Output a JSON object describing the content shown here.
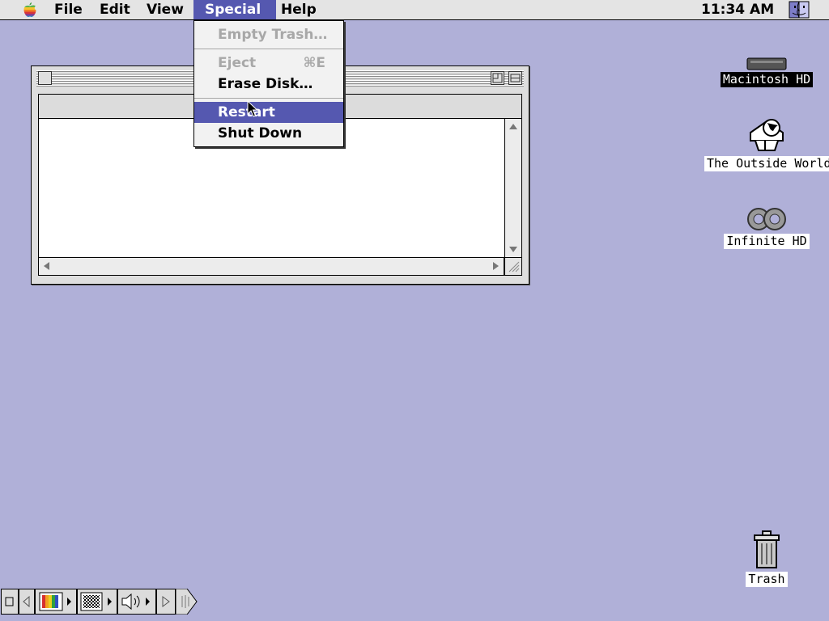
{
  "menubar": {
    "apple_icon": "rainbow-apple-icon",
    "menus": [
      "File",
      "Edit",
      "View",
      "Special",
      "Help"
    ],
    "active_menu": "Special",
    "clock": "11:34 AM",
    "app_icon": "finder-face-icon"
  },
  "special_menu": {
    "items": [
      {
        "label": "Empty Trash…",
        "enabled": false,
        "shortcut": ""
      },
      {
        "label": "Eject",
        "enabled": false,
        "shortcut": "⌘E"
      },
      {
        "label": "Erase Disk…",
        "enabled": true,
        "shortcut": ""
      },
      {
        "label": "Restart",
        "enabled": true,
        "highlighted": true,
        "shortcut": ""
      },
      {
        "label": "Shut Down",
        "enabled": true,
        "shortcut": ""
      }
    ]
  },
  "window": {
    "title": "",
    "scroll_arrow_color": "#777777"
  },
  "desktop": {
    "background_color": "#b0b0d8",
    "icons": [
      {
        "label": "Macintosh HD",
        "icon": "hard-disk-icon",
        "selected": true
      },
      {
        "label": "The Outside World",
        "icon": "internet-globe-icon",
        "selected": false
      },
      {
        "label": "Infinite HD",
        "icon": "infinite-disk-icon",
        "selected": false
      },
      {
        "label": "Trash",
        "icon": "trash-can-icon",
        "selected": false
      }
    ]
  },
  "control_strip": {
    "modules": [
      "color-depth-icon",
      "monitor-resolution-icon",
      "sound-volume-icon"
    ]
  }
}
